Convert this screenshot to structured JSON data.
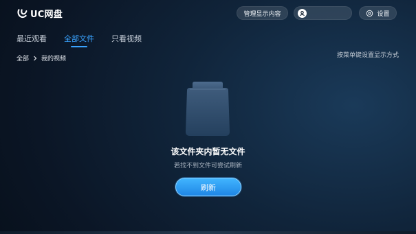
{
  "app": {
    "logo_text": "UC网盘",
    "logo_icon": "uc-logo-icon"
  },
  "header": {
    "manage_label": "管理显示内容",
    "user_name": "",
    "user_icon": "avatar-icon",
    "settings_label": "设置",
    "settings_icon": "gear-icon"
  },
  "tabs": [
    {
      "label": "最近观看",
      "active": false
    },
    {
      "label": "全部文件",
      "active": true
    },
    {
      "label": "只看视频",
      "active": false
    }
  ],
  "breadcrumb": {
    "root": "全部",
    "separator_icon": "chevron-right-icon",
    "current": "我的视频"
  },
  "hint": "按菜单键设置显示方式",
  "empty_state": {
    "icon": "empty-folder-icon",
    "title": "该文件夹内暂无文件",
    "subtitle": "若找不到文件可尝试刷新",
    "refresh_label": "刷新"
  },
  "colors": {
    "accent": "#3aa3ff",
    "button": "#2a98f2",
    "background": "#0e1f33"
  }
}
